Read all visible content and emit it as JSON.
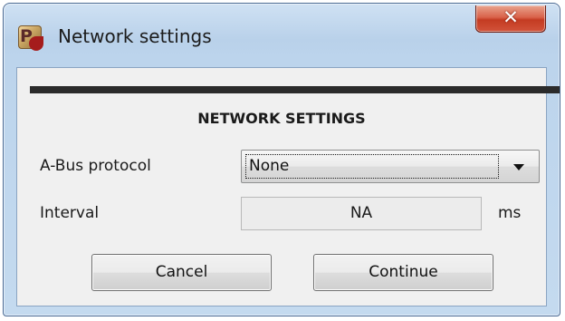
{
  "window": {
    "title": "Network settings",
    "icon": "app-logo-icon",
    "close_glyph": "x"
  },
  "form": {
    "heading": "NETWORK SETTINGS",
    "abus_protocol": {
      "label": "A-Bus protocol",
      "selected": "None"
    },
    "interval": {
      "label": "Interval",
      "value": "NA",
      "unit": "ms"
    }
  },
  "buttons": {
    "cancel": "Cancel",
    "continue": "Continue"
  },
  "colors": {
    "close_button": "#c43b22",
    "title_bar": "#b9d1ea",
    "dialog_background": "#f0f0f0",
    "divider": "#2b2b2b"
  }
}
